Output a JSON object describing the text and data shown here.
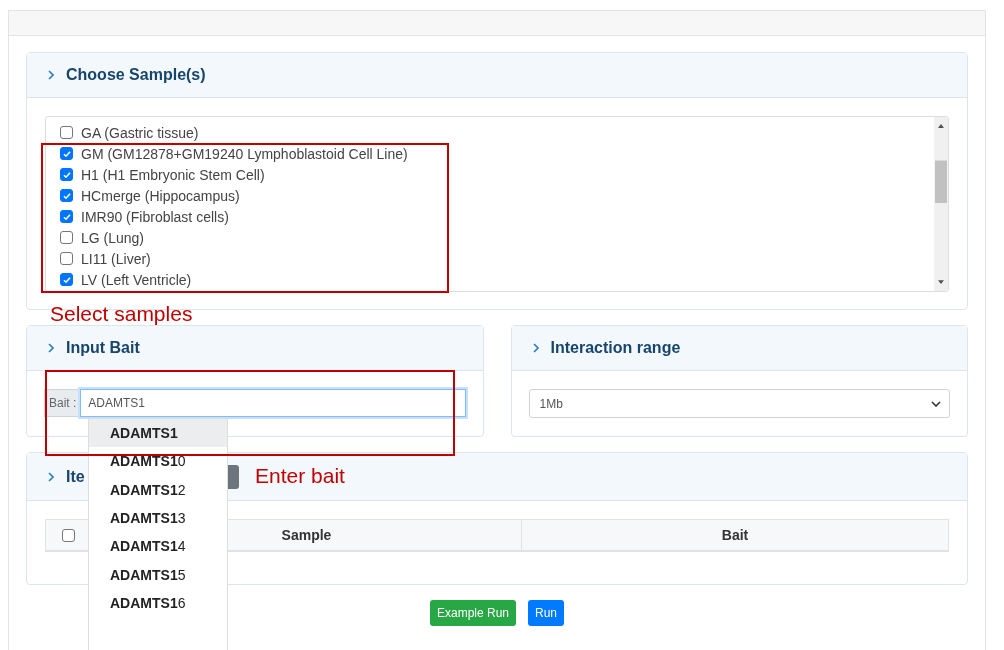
{
  "samples_panel": {
    "title": "Choose Sample(s)",
    "samples": [
      {
        "label": "GA (Gastric tissue)",
        "checked": false
      },
      {
        "label": "GM (GM12878+GM19240 Lymphoblastoid Cell Line)",
        "checked": true
      },
      {
        "label": "H1 (H1 Embryonic Stem Cell)",
        "checked": true
      },
      {
        "label": "HCmerge (Hippocampus)",
        "checked": true
      },
      {
        "label": "IMR90 (Fibroblast cells)",
        "checked": true
      },
      {
        "label": "LG (Lung)",
        "checked": false
      },
      {
        "label": "LI11 (Liver)",
        "checked": false
      },
      {
        "label": "LV (Left Ventricle)",
        "checked": true
      }
    ]
  },
  "bait_panel": {
    "title": "Input Bait",
    "label": "Bait :",
    "value": "ADAMTS1"
  },
  "range_panel": {
    "title": "Interaction range",
    "value": "1Mb"
  },
  "items_panel": {
    "title": "Ite",
    "table": {
      "columns": [
        "Sample",
        "Bait"
      ],
      "all_checked": false
    }
  },
  "suggestions": [
    {
      "text": "**ADAMTS1**",
      "selected": true
    },
    {
      "text": "**ADAMTS1**0",
      "selected": false
    },
    {
      "text": "**ADAMTS1**2",
      "selected": false
    },
    {
      "text": "**ADAMTS1**3",
      "selected": false
    },
    {
      "text": "**ADAMTS1**4",
      "selected": false
    },
    {
      "text": "**ADAMTS1**5",
      "selected": false
    },
    {
      "text": "**ADAMTS1**6",
      "selected": false
    }
  ],
  "buttons": [
    {
      "label": "Example Run",
      "kind": "success"
    },
    {
      "label": "Run",
      "kind": "primary"
    }
  ],
  "annotations": [
    "Select samples",
    "Enter bait"
  ]
}
